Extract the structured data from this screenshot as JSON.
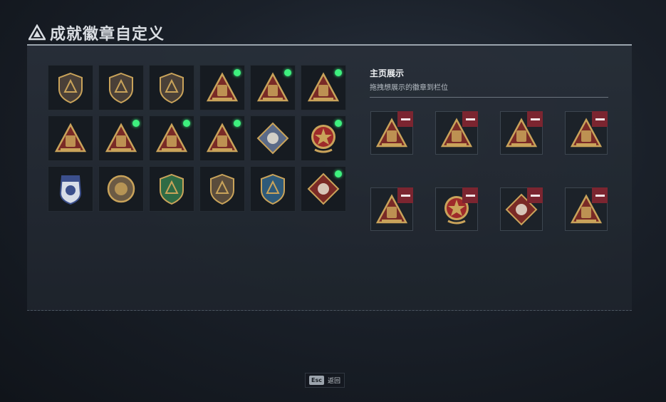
{
  "header": {
    "title": "成就徽章自定义",
    "logo_icon": "triangle-logo-icon"
  },
  "badges": [
    {
      "icon": "triangle-shield-badge-icon",
      "type": "shield",
      "color": "#4a4038",
      "owned": false
    },
    {
      "icon": "helicopter-shield-badge-icon",
      "type": "shield",
      "color": "#4a4038",
      "owned": false
    },
    {
      "icon": "wing-shield-badge-icon",
      "type": "shield",
      "color": "#4a4038",
      "owned": false
    },
    {
      "icon": "backpack-triangle-badge-icon",
      "type": "triangle",
      "color": "#7a2a26",
      "owned": true
    },
    {
      "icon": "radio-58-triangle-badge-icon",
      "type": "triangle",
      "color": "#7a2a26",
      "owned": true
    },
    {
      "icon": "sentry-triangle-badge-icon",
      "type": "triangle",
      "color": "#7a2a26",
      "owned": true
    },
    {
      "icon": "hand-gesture-triangle-badge-icon",
      "type": "triangle",
      "color": "#7a2a26",
      "owned": false
    },
    {
      "icon": "number-one-triangle-badge-icon",
      "type": "triangle",
      "color": "#7a2a26",
      "owned": true
    },
    {
      "icon": "winged-triangle-badge-icon",
      "type": "triangle",
      "color": "#7a2a26",
      "owned": true
    },
    {
      "icon": "soldier-triangle-badge-icon",
      "type": "triangle",
      "color": "#7a2a26",
      "owned": true
    },
    {
      "icon": "crystal-diamond-badge-icon",
      "type": "diamond",
      "color": "#5a6a88",
      "owned": false
    },
    {
      "icon": "star-medal-badge-icon",
      "type": "medal",
      "color": "#9e2a2a",
      "owned": true
    },
    {
      "icon": "blue-police-shield-badge-icon",
      "type": "police",
      "color": "#3b4f8c",
      "owned": false
    },
    {
      "icon": "bronze-cloud-medal-badge-icon",
      "type": "circle",
      "color": "#6b5a44",
      "owned": false
    },
    {
      "icon": "green-crosshair-shield-badge-icon",
      "type": "shield",
      "color": "#2f6b45",
      "owned": false
    },
    {
      "icon": "crossed-circle-shield-badge-icon",
      "type": "shield",
      "color": "#5a4c3c",
      "owned": false
    },
    {
      "icon": "blue-arrows-shield-badge-icon",
      "type": "shield",
      "color": "#2e5a7a",
      "owned": false
    },
    {
      "icon": "wolf-diamond-badge-icon",
      "type": "diamond",
      "color": "#7a2a26",
      "owned": true
    }
  ],
  "showcase": {
    "title": "主页展示",
    "subtitle": "拖拽想展示的徽章到栏位",
    "slots": [
      {
        "icon": "winged-triangle-badge-icon",
        "type": "triangle",
        "color": "#7a2a26"
      },
      {
        "icon": "number-one-triangle-badge-icon",
        "type": "triangle",
        "color": "#7a2a26"
      },
      {
        "icon": "backpack-triangle-badge-icon",
        "type": "triangle",
        "color": "#7a2a26"
      },
      {
        "icon": "radio-58-triangle-badge-icon",
        "type": "triangle",
        "color": "#7a2a26"
      },
      {
        "icon": "soldier-triangle-badge-icon",
        "type": "triangle",
        "color": "#7a2a26"
      },
      {
        "icon": "star-medal-badge-icon",
        "type": "medal",
        "color": "#9e2a2a"
      },
      {
        "icon": "wolf-diamond-badge-icon",
        "type": "diamond",
        "color": "#7a2a26"
      },
      {
        "icon": "sentry-triangle-badge-icon",
        "type": "triangle",
        "color": "#7a2a26"
      }
    ]
  },
  "footer": {
    "key": "Esc",
    "label": "返回"
  },
  "colors": {
    "owned_dot": "#3ef07e",
    "remove_button": "#7b2530",
    "gold": "#c9a35a"
  }
}
